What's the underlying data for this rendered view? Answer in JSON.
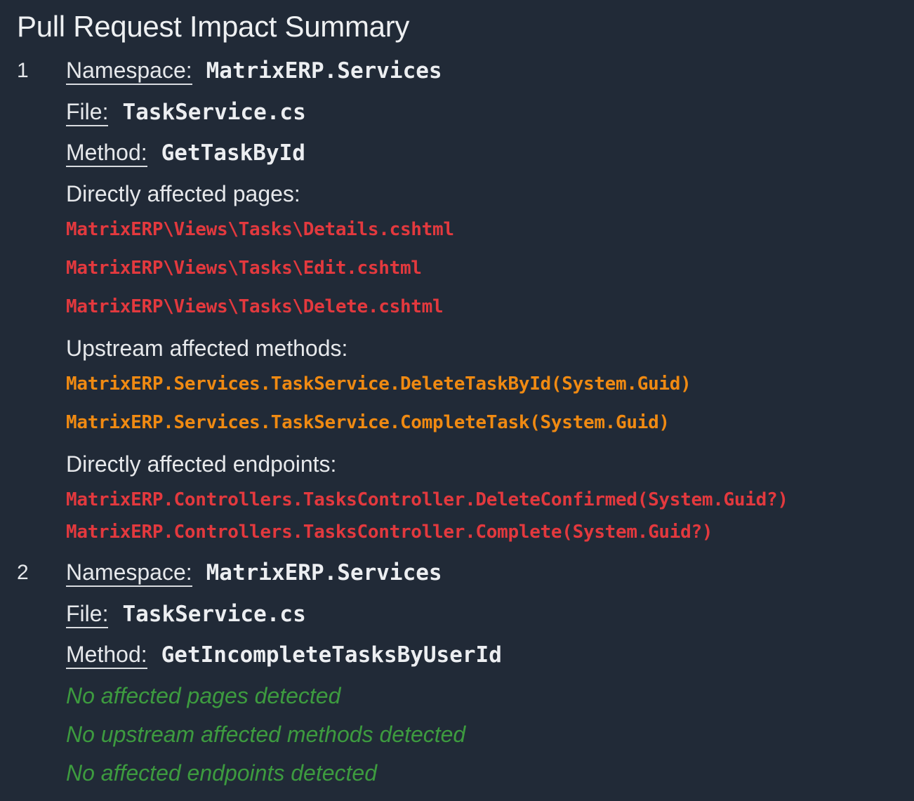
{
  "title": "Pull Request Impact Summary",
  "labels": {
    "namespace": "Namespace:",
    "file": "File:",
    "method": "Method:",
    "pages_header": "Directly affected pages:",
    "methods_header": "Upstream affected methods:",
    "endpoints_header": "Directly affected endpoints:"
  },
  "entries": [
    {
      "number": "1",
      "namespace": "MatrixERP.Services",
      "file": "TaskService.cs",
      "method": "GetTaskById",
      "pages": [
        "MatrixERP\\Views\\Tasks\\Details.cshtml",
        "MatrixERP\\Views\\Tasks\\Edit.cshtml",
        "MatrixERP\\Views\\Tasks\\Delete.cshtml"
      ],
      "upstream_methods": [
        "MatrixERP.Services.TaskService.DeleteTaskById(System.Guid)",
        "MatrixERP.Services.TaskService.CompleteTask(System.Guid)"
      ],
      "endpoints": [
        "MatrixERP.Controllers.TasksController.DeleteConfirmed(System.Guid?)",
        "MatrixERP.Controllers.TasksController.Complete(System.Guid?)"
      ]
    },
    {
      "number": "2",
      "namespace": "MatrixERP.Services",
      "file": "TaskService.cs",
      "method": "GetIncompleteTasksByUserId",
      "no_pages": "No affected pages detected",
      "no_methods": "No upstream affected methods detected",
      "no_endpoints": "No affected endpoints detected"
    }
  ],
  "colors": {
    "background": "#212a37",
    "page_link": "#e3393e",
    "method_link": "#f08a12",
    "endpoint_link": "#e3393e",
    "none_detected": "#3d9b3f"
  }
}
